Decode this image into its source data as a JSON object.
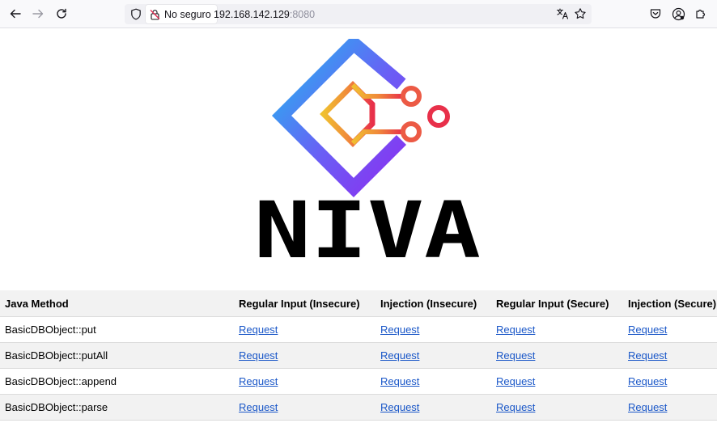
{
  "browser": {
    "security_label": "No seguro",
    "url_host": "192.168.142.129",
    "url_port": ":8080"
  },
  "brand": {
    "name": "NIVA"
  },
  "table": {
    "headers": [
      "Java Method",
      "Regular Input (Insecure)",
      "Injection (Insecure)",
      "Regular Input (Secure)",
      "Injection (Secure)"
    ],
    "rows": [
      {
        "method": "BasicDBObject::put",
        "links": [
          "Request",
          "Request",
          "Request",
          "Request"
        ]
      },
      {
        "method": "BasicDBObject::putAll",
        "links": [
          "Request",
          "Request",
          "Request",
          "Request"
        ]
      },
      {
        "method": "BasicDBObject::append",
        "links": [
          "Request",
          "Request",
          "Request",
          "Request"
        ]
      },
      {
        "method": "BasicDBObject::parse",
        "links": [
          "Request",
          "Request",
          "Request",
          "Request"
        ]
      }
    ]
  },
  "colors": {
    "link": "#1a57c8",
    "header_bg": "#f2f2f2",
    "logo_gradient_start": "#22b8f0",
    "logo_gradient_end": "#7b3ff2",
    "circuit_start": "#f0c030",
    "circuit_end": "#e8304a"
  }
}
